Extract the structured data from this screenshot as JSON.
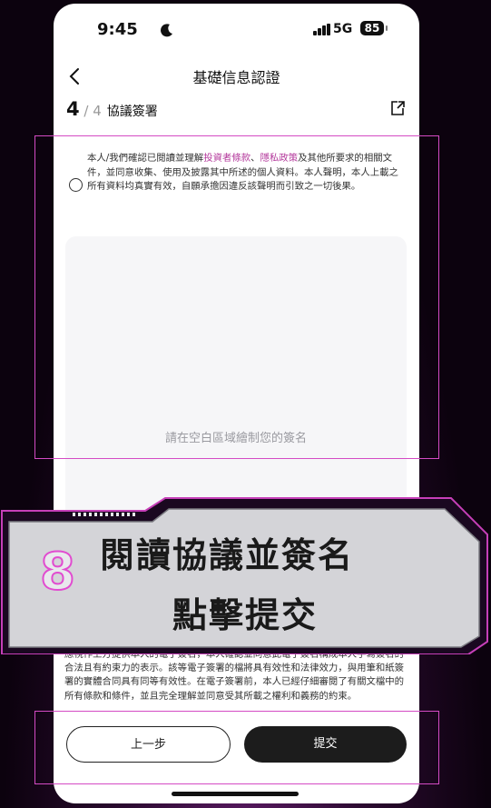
{
  "status_bar": {
    "time": "9:45",
    "network": "5G",
    "battery": "85"
  },
  "nav": {
    "title": "基礎信息認證"
  },
  "progress": {
    "current": "4",
    "total": "4",
    "label": "協議簽署"
  },
  "agreement": {
    "part1": "本人/我們確認已閱讀並理解",
    "link1": "投資者條款",
    "sep": "、",
    "link2": "隱私政策",
    "part2": "及其他所要求的相關文件，並同意收集、使用及披露其中所述的個人資料。本人聲明，本人上載之所有資料均真實有效，自願承擔因違反該聲明而引致之一切後果。"
  },
  "signature": {
    "placeholder": "請在空白區域繪制您的簽名"
  },
  "disclaimer": {
    "text": "應視作上方提供本人的電子簽名，本人確認並同意此電子簽名構成本人手寫簽名的合法且有約束力的表示。該等電子簽署的檔將具有效性和法律效力，與用筆和紙簽署的實體合同具有同等有效性。在電子簽署前，本人已經仔細審閱了有關文檔中的所有條款和條件，並且完全理解並同意受其所載之權利和義務的約束。"
  },
  "buttons": {
    "prev": "上一步",
    "submit": "提交"
  },
  "overlay": {
    "step_number": "8",
    "line1": "閱讀協議並簽名",
    "line2": "點擊提交"
  },
  "colors": {
    "accent": "#b43a9c",
    "highlight": "#d44bc4",
    "button_dark": "#1c1c1c"
  }
}
